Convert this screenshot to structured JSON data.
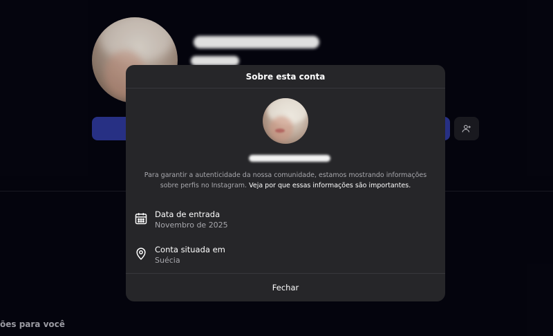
{
  "background": {
    "suggestions_heading": "ões para você",
    "icons": {
      "suggest_user": "person-plus-icon"
    }
  },
  "modal": {
    "title": "Sobre esta conta",
    "info_text": "Para garantir a autenticidade da nossa comunidade, estamos mostrando informações sobre perfis no Instagram.",
    "info_link": "Veja por que essas informações são importantes.",
    "rows": [
      {
        "icon": "calendar-icon",
        "title": "Data de entrada",
        "value": "Novembro de 2025"
      },
      {
        "icon": "location-pin-icon",
        "title": "Conta situada em",
        "value": "Suécia"
      }
    ],
    "close_label": "Fechar"
  },
  "colors": {
    "page_background": "#05050f",
    "modal_background": "#262629",
    "follow_button": "#2b3590",
    "muted_text": "#a8a8ad"
  }
}
